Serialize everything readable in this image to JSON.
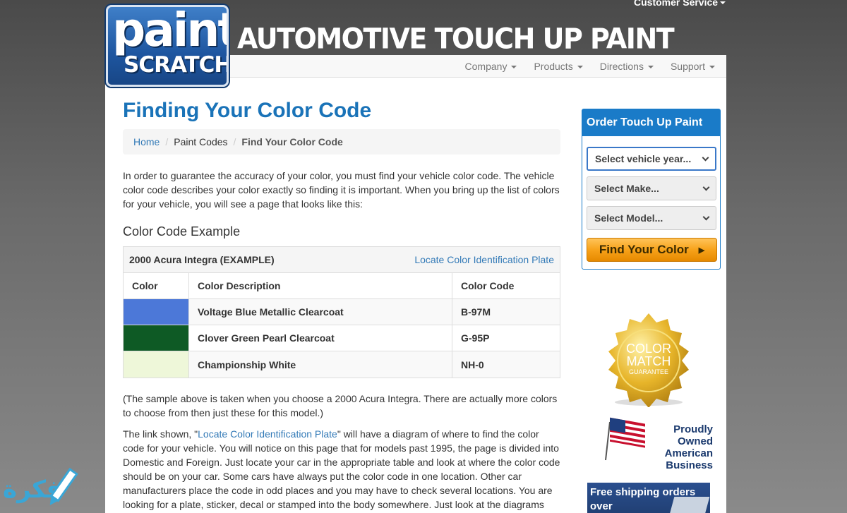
{
  "header": {
    "customer_service": "Customer Service",
    "logo_top": "paint",
    "logo_bottom": "SCRATCH",
    "site_title": "AUTOMOTIVE TOUCH UP PAINT"
  },
  "nav": {
    "items": [
      {
        "label": "Company"
      },
      {
        "label": "Products"
      },
      {
        "label": "Directions"
      },
      {
        "label": "Support"
      }
    ]
  },
  "page": {
    "title": "Finding Your Color Code",
    "breadcrumb": {
      "home": "Home",
      "paint_codes": "Paint Codes",
      "current": "Find Your Color Code"
    },
    "intro": "In order to guarantee the accuracy of your color, you must find your vehicle color code.  The vehicle color code describes your color exactly so finding it is important. When you bring up the list of colors for your vehicle, you will see a page that looks like this:",
    "example_heading": "Color Code Example",
    "example_table": {
      "title": "2000 Acura Integra (EXAMPLE)",
      "link": "Locate Color Identification Plate",
      "headers": [
        "Color",
        "Color Description",
        "Color Code"
      ],
      "rows": [
        {
          "swatch": "#4c78d8",
          "description": "Voltage Blue Metallic Clearcoat",
          "code": "B-97M"
        },
        {
          "swatch": "#0e5a25",
          "description": "Clover Green Pearl Clearcoat",
          "code": "G-95P"
        },
        {
          "swatch": "#eef7d9",
          "description": "Championship White",
          "code": "NH-0"
        }
      ]
    },
    "sample_note": "(The sample above is taken when you choose a 2000 Acura Integra. There are actually more colors to choose from then just these for this model.)",
    "link_para": {
      "before": "The link shown, \"",
      "link": "Locate Color Identification Plate",
      "after": "\" will have a diagram of where to find the color code for your vehicle. You will notice on this page that for models past 1995, the page is divided into Domestic and Foreign. Just locate your car in the appropriate table and look at where the color code should be on your car. Some cars have always put the color code in one location. Other car manufacturers place the code in odd places and you may have to check several locations. You are looking for a plate, sticker, decal or stamped into the body somewhere. Just look at the diagrams"
    }
  },
  "sidebar": {
    "order_title": "Order Touch Up Paint",
    "year_placeholder": "Select vehicle year...",
    "make_placeholder": "Select Make...",
    "model_placeholder": "Select Model...",
    "find_button": "Find Your Color",
    "seal_line1": "COLOR",
    "seal_line2": "MATCH",
    "seal_line3": "GUARANTEE",
    "proud_text": "Proudly Owned American Business",
    "shipping_text": "Free shipping orders over"
  },
  "watermark": {
    "text": "فكرة"
  },
  "colors": {
    "accent": "#1a73b8",
    "panel": "#1a7bc8",
    "button": "#f7a21a"
  }
}
